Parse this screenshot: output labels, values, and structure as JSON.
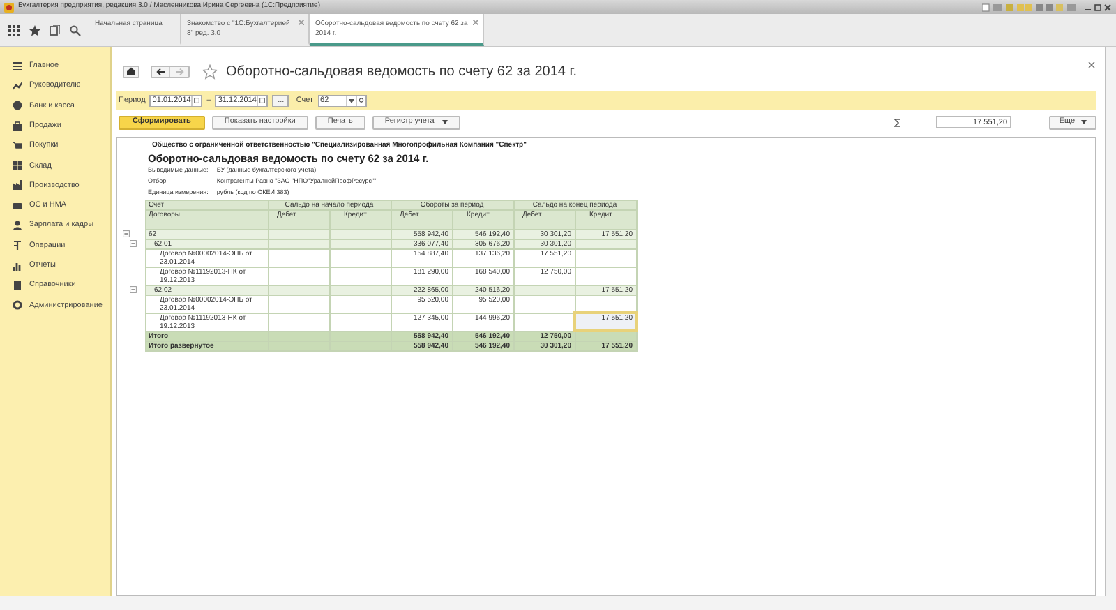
{
  "window": {
    "title": "Бухгалтерия предприятия, редакция 3.0 / Масленникова Ирина Сергеевна (1С:Предприятие)"
  },
  "tabs": [
    {
      "label": "Начальная страница",
      "selected": false,
      "closable": false
    },
    {
      "label": "Знакомство с \"1С:Бухгалтерией 8\" ред. 3.0",
      "selected": false,
      "closable": true
    },
    {
      "label": "Оборотно-сальдовая ведомость по счету 62 за 2014 г.",
      "selected": true,
      "closable": true
    }
  ],
  "sidebar": {
    "items": [
      {
        "label": "Главное"
      },
      {
        "label": "Руководителю"
      },
      {
        "label": "Банк и касса"
      },
      {
        "label": "Продажи"
      },
      {
        "label": "Покупки"
      },
      {
        "label": "Склад"
      },
      {
        "label": "Производство"
      },
      {
        "label": "ОС и НМА"
      },
      {
        "label": "Зарплата и кадры"
      },
      {
        "label": "Операции"
      },
      {
        "label": "Отчеты"
      },
      {
        "label": "Справочники"
      },
      {
        "label": "Администрирование"
      }
    ]
  },
  "page": {
    "title": "Оборотно-сальдовая ведомость по счету 62 за 2014 г."
  },
  "filter": {
    "period_label": "Период",
    "date_from": "01.01.2014",
    "dash": "–",
    "date_to": "31.12.2014",
    "more": "...",
    "account_label": "Счет",
    "account": "62"
  },
  "toolbar": {
    "buttons": [
      {
        "label": "Сформировать",
        "kind": "primary"
      },
      {
        "label": "Показать настройки",
        "kind": "plain"
      },
      {
        "label": "Печать",
        "kind": "plain"
      },
      {
        "label": "Регистр учета",
        "kind": "dropdown"
      }
    ],
    "sum": "17 551,20",
    "more": "Еще"
  },
  "report": {
    "organization": "Общество с ограниченной ответственностью \"Специализированная Многопрофильная Компания \"Спектр\"",
    "title": "Оборотно-сальдовая ведомость по счету 62 за 2014 г.",
    "params": [
      {
        "label": "Выводимые данные:",
        "value": "БУ (данные бухгалтерского учета)"
      },
      {
        "label": "Отбор:",
        "value": "Контрагенты Равно \"ЗАО \"НПО\"УралнейПрофРесурс\"\""
      },
      {
        "label": "Единица измерения:",
        "value": "рубль (код по ОКЕИ 383)"
      }
    ],
    "header": {
      "col1_top": "Счет",
      "col1_bottom": "Договоры",
      "groups": [
        "Сальдо на начало периода",
        "Обороты за период",
        "Сальдо на конец периода"
      ],
      "sub": [
        "Дебет",
        "Кредит",
        "Дебет",
        "Кредит",
        "Дебет",
        "Кредит"
      ]
    },
    "rows": [
      {
        "kind": "group",
        "label": "62",
        "turnover_debit": "558 942,40",
        "turnover_credit": "546 192,40",
        "end_debit": "30 301,20",
        "end_credit": "17 551,20",
        "expanded": true,
        "selected": false,
        "children": [
          {
            "kind": "group",
            "label": "62.01",
            "turnover_debit": "336 077,40",
            "turnover_credit": "305 676,20",
            "end_debit": "30 301,20",
            "expanded": true,
            "selected": false,
            "children": [
              {
                "kind": "item",
                "label": "Договор №00002014-ЭПБ от 23.01.2014",
                "turnover_debit": "154 887,40",
                "turnover_credit": "137 136,20",
                "end_debit": "17 551,20",
                "selected": false
              },
              {
                "kind": "item",
                "label": "Договор №11192013-НК от 19.12.2013",
                "turnover_debit": "181 290,00",
                "turnover_credit": "168 540,00",
                "end_debit": "12 750,00",
                "selected": false
              }
            ]
          },
          {
            "kind": "group",
            "label": "62.02",
            "turnover_debit": "222 865,00",
            "turnover_credit": "240 516,20",
            "end_credit": "17 551,20",
            "expanded": true,
            "selected": false,
            "children": [
              {
                "kind": "item",
                "label": "Договор №00002014-ЭПБ от 23.01.2014",
                "turnover_debit": "95 520,00",
                "turnover_credit": "95 520,00",
                "selected": false
              },
              {
                "kind": "item",
                "label": "Договор №11192013-НК от 19.12.2013",
                "turnover_debit": "127 345,00",
                "turnover_credit": "144 996,20",
                "end_credit": "17 551,20",
                "selected": true
              }
            ]
          }
        ]
      },
      {
        "kind": "total",
        "label": "Итого",
        "turnover_debit": "558 942,40",
        "turnover_credit": "546 192,40",
        "end_debit": "12 750,00",
        "selected": false
      },
      {
        "kind": "total",
        "label": "Итого развернутое",
        "turnover_debit": "558 942,40",
        "turnover_credit": "546 192,40",
        "end_debit": "30 301,20",
        "end_credit": "17 551,20",
        "selected": false
      }
    ]
  }
}
